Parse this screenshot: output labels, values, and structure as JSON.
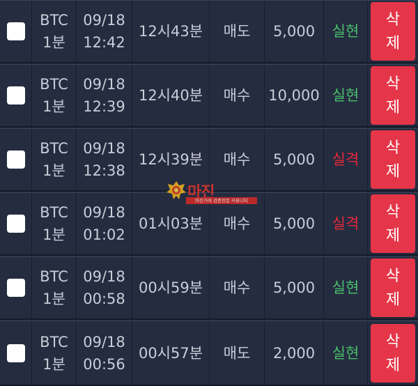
{
  "rows": [
    {
      "coin": "BTC",
      "interval": "1분",
      "date": "09/18",
      "clock": "12:42",
      "round": "12시43분",
      "side": "매도",
      "amount": "5,000",
      "result": "실현",
      "result_type": "win",
      "delete_label_1": "삭",
      "delete_label_2": "제"
    },
    {
      "coin": "BTC",
      "interval": "1분",
      "date": "09/18",
      "clock": "12:39",
      "round": "12시40분",
      "side": "매수",
      "amount": "10,000",
      "result": "실현",
      "result_type": "win",
      "delete_label_1": "삭",
      "delete_label_2": "제"
    },
    {
      "coin": "BTC",
      "interval": "1분",
      "date": "09/18",
      "clock": "12:38",
      "round": "12시39분",
      "side": "매수",
      "amount": "5,000",
      "result": "실격",
      "result_type": "loss",
      "delete_label_1": "삭",
      "delete_label_2": "제"
    },
    {
      "coin": "BTC",
      "interval": "1분",
      "date": "09/18",
      "clock": "01:02",
      "round": "01시03분",
      "side": "매수",
      "amount": "5,000",
      "result": "실격",
      "result_type": "loss",
      "delete_label_1": "삭",
      "delete_label_2": "제"
    },
    {
      "coin": "BTC",
      "interval": "1분",
      "date": "09/18",
      "clock": "00:58",
      "round": "00시59분",
      "side": "매수",
      "amount": "5,000",
      "result": "실현",
      "result_type": "win",
      "delete_label_1": "삭",
      "delete_label_2": "제"
    },
    {
      "coin": "BTC",
      "interval": "1분",
      "date": "09/18",
      "clock": "00:56",
      "round": "00시57분",
      "side": "매도",
      "amount": "2,000",
      "result": "실현",
      "result_type": "win",
      "delete_label_1": "삭",
      "delete_label_2": "제"
    }
  ],
  "watermark": {
    "title": "마진",
    "sub": "마진거래 검증전문 커뮤니티",
    "icon": "eagle-badge-icon"
  },
  "colors": {
    "background": "#252c40",
    "win": "#49c16b",
    "loss": "#e8283a",
    "delete_button": "#e53548"
  }
}
